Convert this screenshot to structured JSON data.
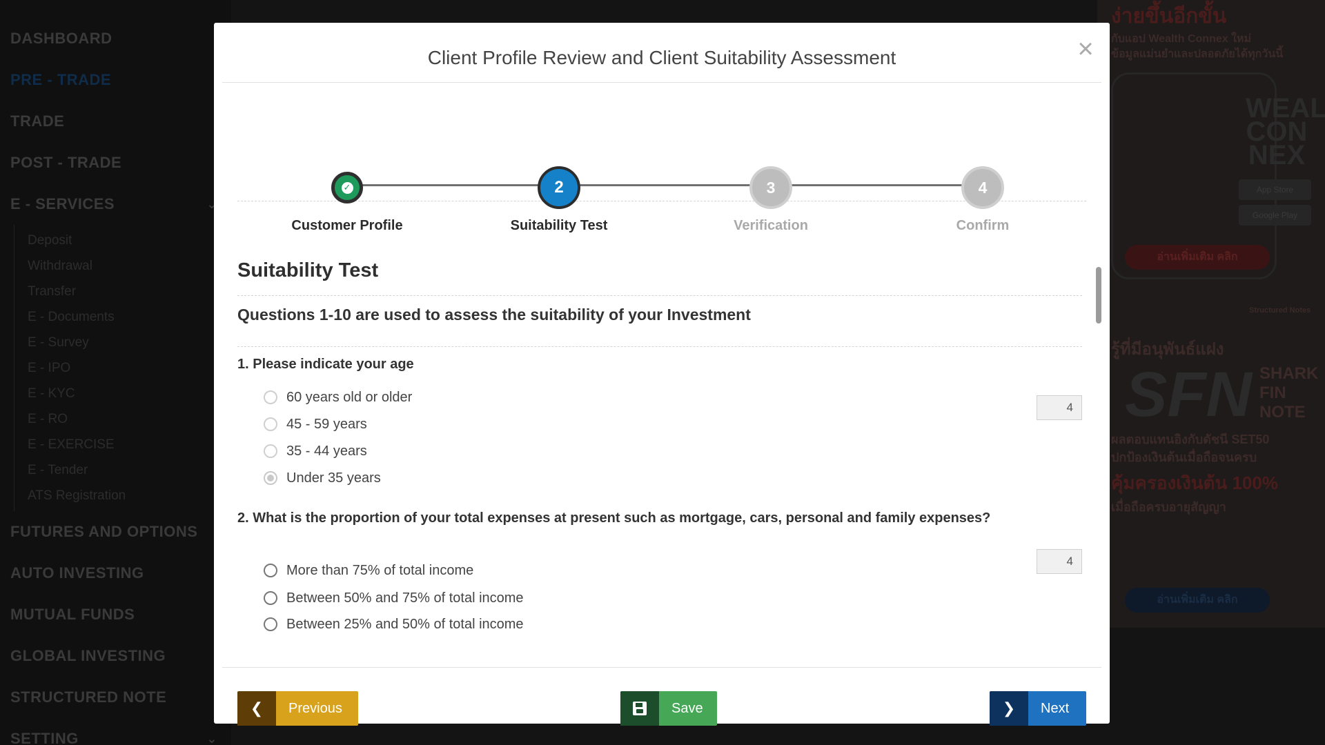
{
  "background": {
    "sidebar": {
      "menu": [
        {
          "label": "DASHBOARD"
        },
        {
          "label": "PRE - TRADE"
        },
        {
          "label": "TRADE"
        },
        {
          "label": "POST - TRADE"
        },
        {
          "label": "E - SERVICES"
        }
      ],
      "e_services_items": [
        "Deposit",
        "Withdrawal",
        "Transfer",
        "E - Documents",
        "E - Survey",
        "E - IPO",
        "E - KYC",
        "E - RO",
        "E - EXERCISE",
        "E - Tender",
        "ATS Registration"
      ],
      "menu_bottom": [
        "FUTURES AND OPTIONS",
        "AUTO INVESTING",
        "MUTUAL FUNDS",
        "GLOBAL INVESTING",
        "STRUCTURED NOTE",
        "SETTING"
      ]
    },
    "ad": {
      "headline": "ง่ายขึ้นอีกขั้น",
      "line1": "กับแอป Wealth Connex ใหม่",
      "line2": "ข้อมูลแม่นยำและปลอดภัยได้ทุกวันนี้",
      "brand": "WEALTH CON NEX",
      "store1": "App Store",
      "store2": "Google Play",
      "cta1": "อ่านเพิ่มเติม คลิก",
      "tag": "Structured Notes",
      "headline2": "รู้ที่มีอนุพันธ์แฝง",
      "big": "SFN",
      "big_side": "SHARK FIN NOTE",
      "desc1": "ผลตอบแทนอิงกับดัชนี SET50",
      "desc2": "ปกป้องเงินต้นเมื่อถือจนครบ",
      "desc3": "คุ้มครองเงินต้น 100%",
      "desc4": "เมื่อถือครบอายุสัญญา",
      "cta2": "อ่านเพิ่มเติม คลิก"
    }
  },
  "modal": {
    "title": "Client Profile Review and Client Suitability Assessment",
    "close_label": "×",
    "steps": [
      {
        "number": "",
        "label": "Customer Profile",
        "state": "done"
      },
      {
        "number": "2",
        "label": "Suitability Test",
        "state": "current"
      },
      {
        "number": "3",
        "label": "Verification",
        "state": "pending"
      },
      {
        "number": "4",
        "label": "Confirm",
        "state": "pending"
      }
    ],
    "section_title": "Suitability Test",
    "sub_title": "Questions 1-10 are used to assess the suitability of your Investment",
    "questions": [
      {
        "text": "1. Please indicate your age",
        "score": "4",
        "options": [
          "60 years old or older",
          "45 - 59 years",
          "35 - 44 years",
          "Under 35 years"
        ],
        "selected_index": 3
      },
      {
        "text": "2. What is the proportion of your total expenses at present such as mortgage, cars, personal and family expenses?",
        "score": "4",
        "options": [
          "More than 75% of total income",
          "Between 50% and 75% of total income",
          "Between 25% and 50% of total income"
        ]
      }
    ],
    "footer": {
      "previous_label": "Previous",
      "save_label": "Save",
      "next_label": "Next"
    }
  },
  "colors": {
    "done": "#1e9a5a",
    "current": "#1481c8",
    "pending": "#bdbdbd",
    "previous_button": "#d9a21c",
    "save_button": "#46a857",
    "next_button": "#1f72c0"
  }
}
